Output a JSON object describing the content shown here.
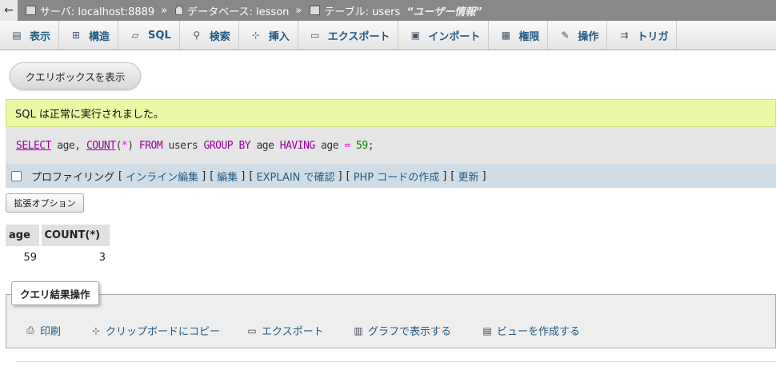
{
  "breadcrumb": {
    "back_icon": "←",
    "server_label": "サーバ: localhost:8889",
    "sep1": "»",
    "database_label": "データベース: lesson",
    "sep2": "»",
    "table_label": "テーブル: users",
    "table_comment": "“ユーザー情報”"
  },
  "tabs": [
    {
      "label": "表示",
      "icon": "▤"
    },
    {
      "label": "構造",
      "icon": "⊞"
    },
    {
      "label": "SQL",
      "icon": "▱"
    },
    {
      "label": "検索",
      "icon": "⚲"
    },
    {
      "label": "挿入",
      "icon": "⊹"
    },
    {
      "label": "エクスポート",
      "icon": "▭"
    },
    {
      "label": "インポート",
      "icon": "▣"
    },
    {
      "label": "権限",
      "icon": "▦"
    },
    {
      "label": "操作",
      "icon": "✎"
    },
    {
      "label": "トリガ",
      "icon": "⇉"
    }
  ],
  "query_box_button": "クエリボックスを表示",
  "success_message": "SQL は正常に実行されました。",
  "sql": {
    "select": "SELECT",
    "part1": " age, ",
    "count": "COUNT",
    "paren_open": "(",
    "star": "*",
    "paren_close": ")",
    "from": " FROM",
    "table": " users ",
    "group_by": "GROUP BY",
    "age2": " age ",
    "having": "HAVING",
    "age3": " age ",
    "eq": "=",
    "space": " ",
    "num": "59",
    "semi": ";"
  },
  "profiling": {
    "label": "プロファイリング",
    "lb": "[",
    "rb": "]",
    "inline_edit": "インライン編集",
    "edit": "編集",
    "explain": "EXPLAIN で確認",
    "php": "PHP コードの作成",
    "refresh": "更新"
  },
  "extended_options": "拡張オプション",
  "results": {
    "headers": [
      "age",
      "COUNT(*)"
    ],
    "rows": [
      [
        "59",
        "3"
      ]
    ]
  },
  "operations": {
    "legend": "クエリ結果操作",
    "items": [
      {
        "label": "印刷",
        "icon": "⎙"
      },
      {
        "label": "クリップボードにコピー",
        "icon": "⊹"
      },
      {
        "label": "エクスポート",
        "icon": "▭"
      },
      {
        "label": "グラフで表示する",
        "icon": "▥"
      },
      {
        "label": "ビューを作成する",
        "icon": "▤"
      }
    ]
  }
}
